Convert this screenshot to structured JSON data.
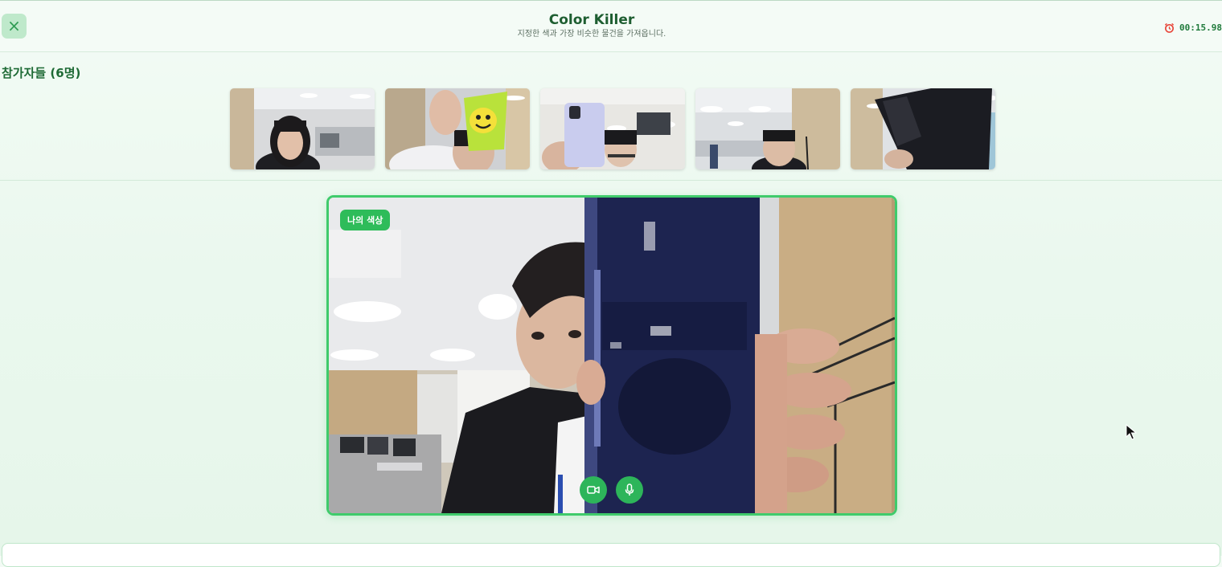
{
  "header": {
    "close_icon": "×",
    "title": "Color Killer",
    "subtitle": "지정한 색과 가장 비슷한 물건을 가져옵니다.",
    "timer": "00:15.98"
  },
  "participants": {
    "title": "참가자들 (6명)",
    "thumbnails": [
      {
        "name": "participant-1"
      },
      {
        "name": "participant-2"
      },
      {
        "name": "participant-3"
      },
      {
        "name": "participant-4"
      },
      {
        "name": "participant-5"
      }
    ]
  },
  "main_video": {
    "tag": "나의 색상"
  },
  "colors": {
    "accent": "#2ebc5a",
    "border": "#3fcb6b",
    "title": "#1e5e31",
    "background": "#eaf8ee"
  }
}
